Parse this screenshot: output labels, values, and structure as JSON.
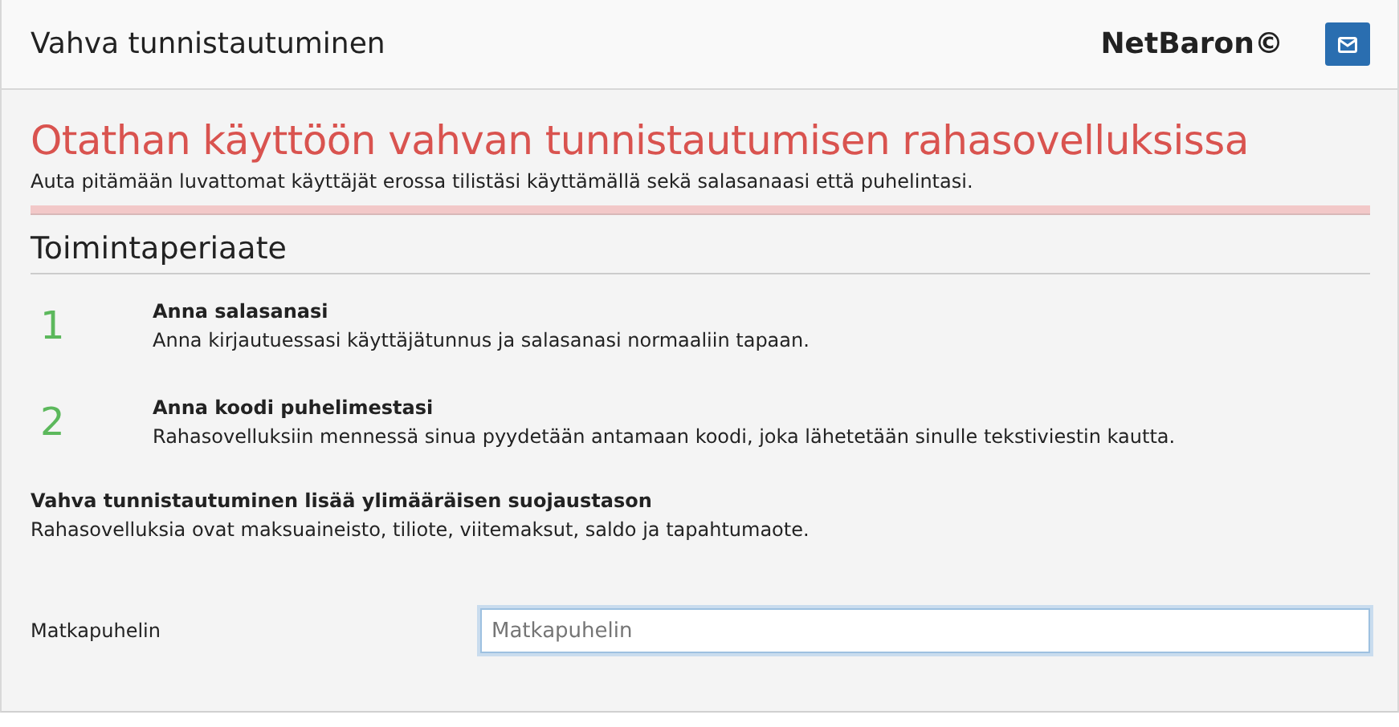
{
  "header": {
    "title": "Vahva tunnistautuminen",
    "brand": "NetBaron©"
  },
  "intro": {
    "title": "Otathan käyttöön vahvan tunnistautumisen rahasovelluksissa",
    "text": "Auta pitämään luvattomat käyttäjät erossa tilistäsi käyttämällä sekä salasanaasi että puhelintasi."
  },
  "section": {
    "title": "Toimintaperiaate"
  },
  "steps": [
    {
      "number": "1",
      "title": "Anna salasanasi",
      "text": "Anna kirjautuessasi käyttäjätunnus ja salasanasi normaaliin tapaan."
    },
    {
      "number": "2",
      "title": "Anna koodi puhelimestasi",
      "text": "Rahasovelluksiin mennessä sinua pyydetään antamaan koodi, joka lähetetään sinulle tekstiviestin kautta."
    }
  ],
  "note": {
    "title": "Vahva tunnistautuminen lisää ylimääräisen suojaustason",
    "text": "Rahasovelluksia ovat maksuaineisto, tiliote, viitemaksut, saldo ja tapahtumaote."
  },
  "phone_field": {
    "label": "Matkapuhelin",
    "placeholder": "Matkapuhelin"
  }
}
